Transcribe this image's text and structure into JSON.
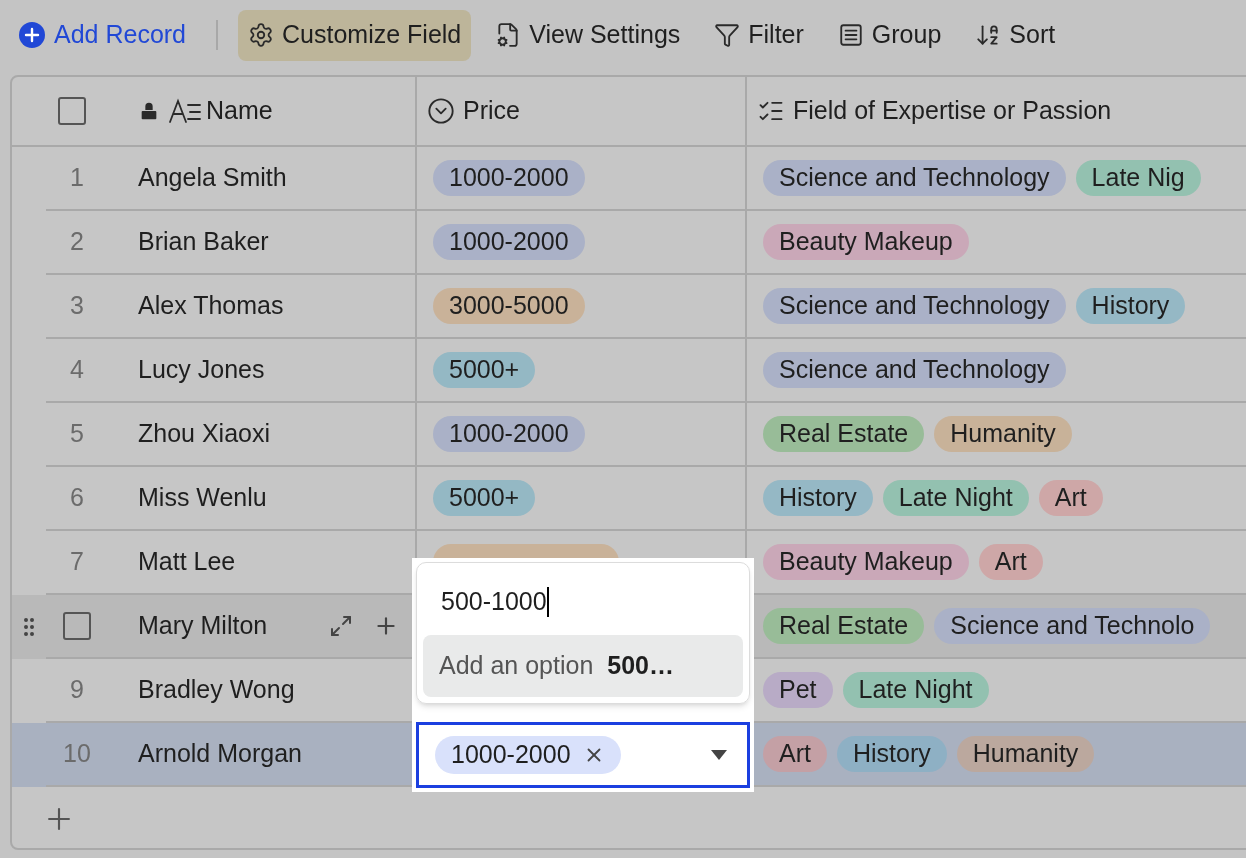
{
  "toolbar": [
    {
      "kind": "add",
      "label": "Add Record",
      "selected": false
    },
    {
      "kind": "customize",
      "label": "Customize Field",
      "selected": true
    },
    {
      "kind": "view",
      "label": "View Settings",
      "selected": false
    },
    {
      "kind": "filter",
      "label": "Filter",
      "selected": false
    },
    {
      "kind": "group",
      "label": "Group",
      "selected": false
    },
    {
      "kind": "sort",
      "label": "Sort",
      "selected": false
    }
  ],
  "table": {
    "select_all": {
      "checked": false
    },
    "columns": [
      {
        "kind": "name",
        "label": "Name"
      },
      {
        "kind": "select",
        "label": "Price"
      },
      {
        "kind": "multi",
        "label": "Field of Expertise or Passion"
      }
    ],
    "rows": [
      {
        "index": "1",
        "name": "Angela Smith",
        "hovered": false,
        "selected": false,
        "price": {
          "label": "1000-2000",
          "color": "#aab1c7"
        },
        "expertise": [
          {
            "label": "Science and Technology",
            "color": "#aab1c7"
          },
          {
            "label": "Late Nig",
            "color": "#93c1b0"
          }
        ]
      },
      {
        "index": "2",
        "name": "Brian Baker",
        "hovered": false,
        "selected": false,
        "price": {
          "label": "1000-2000",
          "color": "#aab1c7"
        },
        "expertise": [
          {
            "label": "Beauty Makeup",
            "color": "#caa8b8"
          }
        ]
      },
      {
        "index": "3",
        "name": "Alex Thomas",
        "hovered": false,
        "selected": false,
        "price": {
          "label": "3000-5000",
          "color": "#c9b299"
        },
        "expertise": [
          {
            "label": "Science and Technology",
            "color": "#aab1c7"
          },
          {
            "label": "History",
            "color": "#95b8c5"
          }
        ]
      },
      {
        "index": "4",
        "name": "Lucy Jones",
        "hovered": false,
        "selected": false,
        "price": {
          "label": "5000+",
          "color": "#94b8c4"
        },
        "expertise": [
          {
            "label": "Science and Technology",
            "color": "#aab1c7"
          }
        ]
      },
      {
        "index": "5",
        "name": "Zhou Xiaoxi",
        "hovered": false,
        "selected": false,
        "price": {
          "label": "1000-2000",
          "color": "#aab1c7"
        },
        "expertise": [
          {
            "label": "Real Estate",
            "color": "#98bc98"
          },
          {
            "label": "Humanity",
            "color": "#c8b299"
          }
        ]
      },
      {
        "index": "6",
        "name": "Miss Wenlu",
        "hovered": false,
        "selected": false,
        "price": {
          "label": "5000+",
          "color": "#94b8c4"
        },
        "expertise": [
          {
            "label": "History",
            "color": "#95b8c5"
          },
          {
            "label": "Late Night",
            "color": "#93c1b0"
          },
          {
            "label": "Art",
            "color": "#cea7a7"
          }
        ]
      },
      {
        "index": "7",
        "name": "Matt Lee",
        "hovered": false,
        "selected": false,
        "price": {
          "color": "#c9b299"
        },
        "expertise": [
          {
            "label": "Beauty Makeup",
            "color": "#caa8b8"
          },
          {
            "label": "Art",
            "color": "#cea7a7"
          }
        ]
      },
      {
        "name": "Mary Milton",
        "hovered": true,
        "checked": false,
        "selected": false,
        "expertise": [
          {
            "label": "Real Estate",
            "color": "#98bc98"
          },
          {
            "label": "Science and Technolo",
            "color": "#aab1c7"
          }
        ]
      },
      {
        "index": "9",
        "name": "Bradley Wong",
        "hovered": false,
        "selected": false,
        "expertise": [
          {
            "label": "Pet",
            "color": "#b8abc6"
          },
          {
            "label": "Late Night",
            "color": "#93c1b0"
          }
        ]
      },
      {
        "index": "10",
        "name": "Arnold Morgan",
        "hovered": false,
        "selected": true,
        "expertise": [
          {
            "label": "Art",
            "color": "#c4a0a5"
          },
          {
            "label": "History",
            "color": "#8eb0c4"
          },
          {
            "label": "Humanity",
            "color": "#bba89e"
          }
        ]
      }
    ]
  },
  "editor": {
    "input_value": "500-1000",
    "option_prefix": "Add an option",
    "option_value": "500…",
    "tag": "1000-2000"
  }
}
